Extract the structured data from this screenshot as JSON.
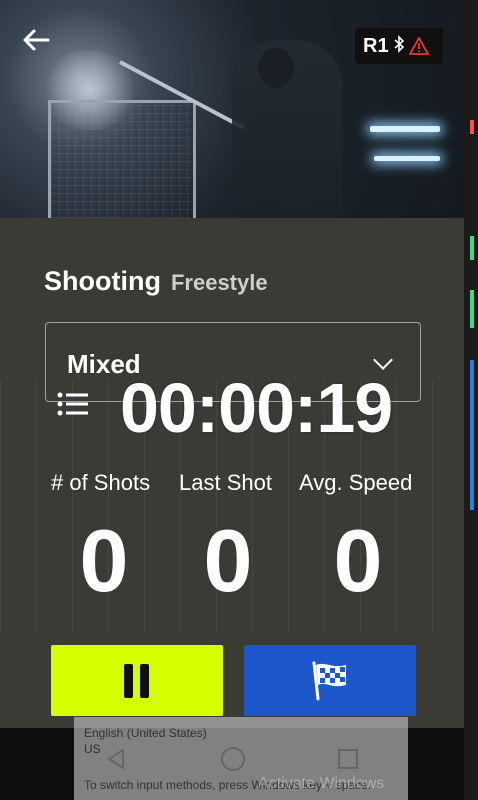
{
  "header": {
    "back_icon": "arrow-left-icon",
    "device_name": "R1",
    "bluetooth_icon": "bluetooth-icon",
    "warning_icon": "warning-triangle-icon"
  },
  "session": {
    "title": "Shooting",
    "subtitle": "Freestyle",
    "mode_value": "Mixed",
    "timer": "00:00:19"
  },
  "stats": [
    {
      "label": "# of Shots",
      "value": "0"
    },
    {
      "label": "Last Shot",
      "value": "0"
    },
    {
      "label": "Avg. Speed",
      "value": "0"
    }
  ],
  "controls": {
    "pause_icon": "pause-icon",
    "finish_icon": "checkered-flag-icon"
  },
  "colors": {
    "accent_yellow": "#d6ff00",
    "accent_blue": "#1e57c9",
    "panel": "#3b3b36"
  },
  "system": {
    "ime_language": "English (United States)",
    "ime_region": "US",
    "ime_hint": "To switch input methods, press Windows key + space.",
    "watermark": "Activate Windows"
  }
}
